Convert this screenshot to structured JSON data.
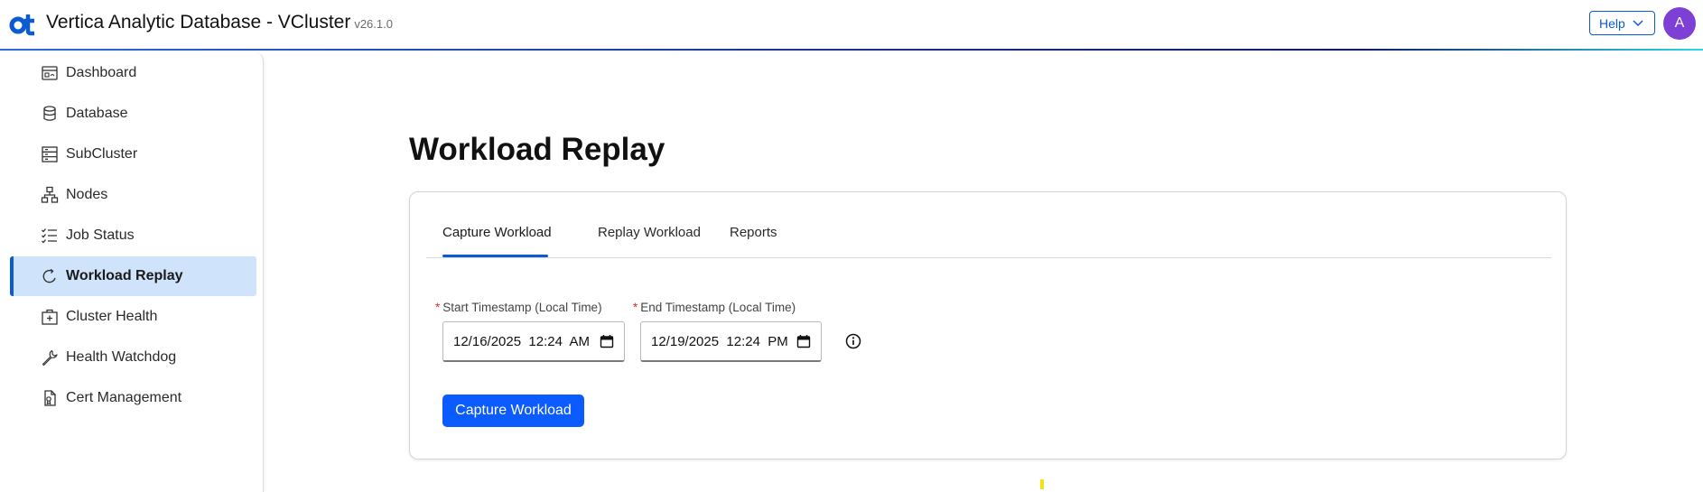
{
  "header": {
    "title": "Vertica Analytic Database - VCluster",
    "version": "v26.1.0",
    "help_label": "Help",
    "avatar_initial": "A",
    "logo_icon": "ot-logo-icon",
    "brand_color": "#0b5bd3",
    "avatar_color": "#7d3fd6"
  },
  "sidebar": {
    "items": [
      {
        "label": "Dashboard",
        "icon": "dashboard-icon"
      },
      {
        "label": "Database",
        "icon": "database-icon"
      },
      {
        "label": "SubCluster",
        "icon": "subcluster-icon"
      },
      {
        "label": "Nodes",
        "icon": "nodes-icon"
      },
      {
        "label": "Job Status",
        "icon": "checklist-icon"
      },
      {
        "label": "Workload Replay",
        "icon": "replay-icon",
        "active": true
      },
      {
        "label": "Cluster Health",
        "icon": "medical-kit-icon"
      },
      {
        "label": "Health Watchdog",
        "icon": "wrench-icon"
      },
      {
        "label": "Cert Management",
        "icon": "certificate-icon"
      }
    ]
  },
  "main": {
    "title": "Workload Replay",
    "tabs": [
      {
        "label": "Capture Workload",
        "active": true
      },
      {
        "label": "Replay Workload"
      },
      {
        "label": "Reports"
      }
    ],
    "form": {
      "start_label": "Start Timestamp (Local Time)",
      "start_value": "12/16/2025  12:24  AM",
      "end_label": "End Timestamp (Local Time)",
      "end_value": "12/19/2025  12:24  PM",
      "required_mark": "*",
      "submit_label": "Capture Workload"
    }
  }
}
